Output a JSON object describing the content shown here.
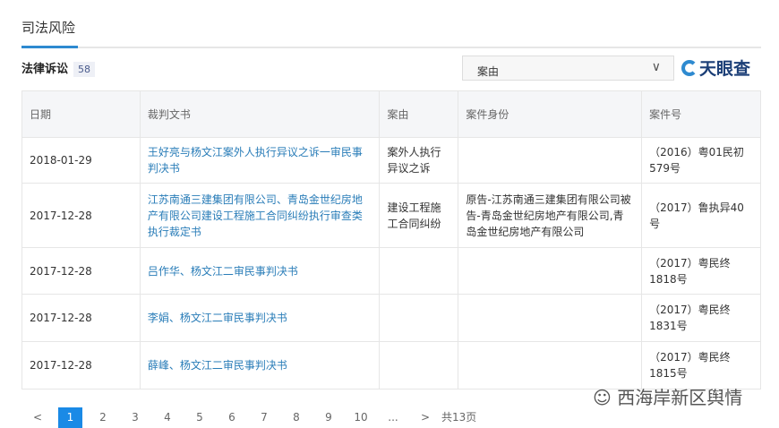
{
  "tab": "司法风险",
  "section": {
    "title": "法律诉讼",
    "count": "58"
  },
  "filter": {
    "selected": "案由"
  },
  "logo": "天眼查",
  "columns": [
    "日期",
    "裁判文书",
    "案由",
    "案件身份",
    "案件号"
  ],
  "rows": [
    {
      "date": "2018-01-29",
      "doc": "王好亮与杨文江案外人执行异议之诉一审民事判决书",
      "cause": "案外人执行异议之诉",
      "role": "",
      "no": "（2016）粤01民初579号"
    },
    {
      "date": "2017-12-28",
      "doc": "江苏南通三建集团有限公司、青岛金世纪房地产有限公司建设工程施工合同纠纷执行审查类执行裁定书",
      "cause": "建设工程施工合同纠纷",
      "role": "原告-江苏南通三建集团有限公司被告-青岛金世纪房地产有限公司,青岛金世纪房地产有限公司",
      "no": "（2017）鲁执异40号"
    },
    {
      "date": "2017-12-28",
      "doc": "吕作华、杨文江二审民事判决书",
      "cause": "",
      "role": "",
      "no": "（2017）粤民终1818号"
    },
    {
      "date": "2017-12-28",
      "doc": "李娟、杨文江二审民事判决书",
      "cause": "",
      "role": "",
      "no": "（2017）粤民终1831号"
    },
    {
      "date": "2017-12-28",
      "doc": "薛峰、杨文江二审民事判决书",
      "cause": "",
      "role": "",
      "no": "（2017）粤民终1815号"
    }
  ],
  "pager": {
    "prev": "<",
    "pages": [
      "1",
      "2",
      "3",
      "4",
      "5",
      "6",
      "7",
      "8",
      "9",
      "10"
    ],
    "ellipsis": "...",
    "next": ">",
    "total": "共13页",
    "current": "1"
  },
  "watermark": "西海岸新区舆情"
}
